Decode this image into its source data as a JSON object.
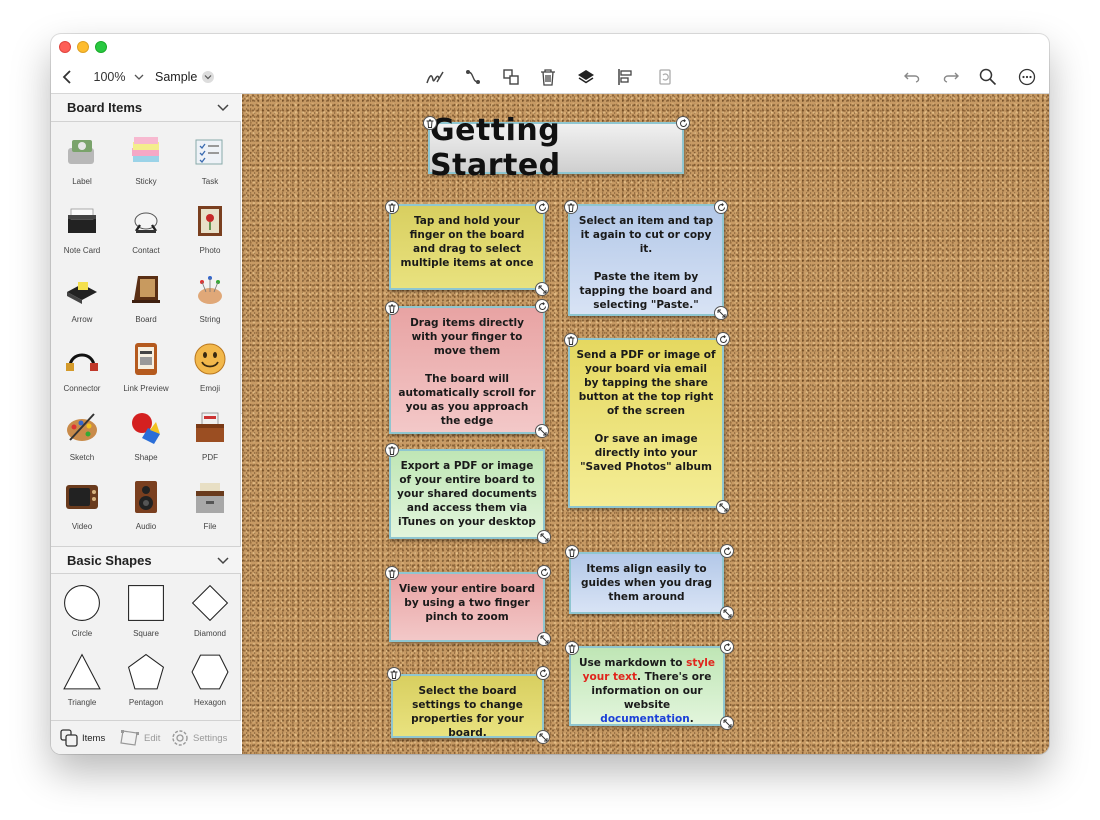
{
  "toolbar": {
    "zoom": "100%",
    "board_name": "Sample"
  },
  "sidebar": {
    "board_items_title": "Board Items",
    "items": [
      {
        "label": "Label"
      },
      {
        "label": "Sticky"
      },
      {
        "label": "Task"
      },
      {
        "label": "Note Card"
      },
      {
        "label": "Contact"
      },
      {
        "label": "Photo"
      },
      {
        "label": "Arrow"
      },
      {
        "label": "Board"
      },
      {
        "label": "String"
      },
      {
        "label": "Connector"
      },
      {
        "label": "Link Preview"
      },
      {
        "label": "Emoji"
      },
      {
        "label": "Sketch"
      },
      {
        "label": "Shape"
      },
      {
        "label": "PDF"
      },
      {
        "label": "Video"
      },
      {
        "label": "Audio"
      },
      {
        "label": "File"
      }
    ],
    "basic_shapes_title": "Basic Shapes",
    "shapes": [
      {
        "label": "Circle"
      },
      {
        "label": "Square"
      },
      {
        "label": "Diamond"
      },
      {
        "label": "Triangle"
      },
      {
        "label": "Pentagon"
      },
      {
        "label": "Hexagon"
      }
    ],
    "tabs": [
      {
        "label": "Items"
      },
      {
        "label": "Edit"
      },
      {
        "label": "Settings"
      }
    ]
  },
  "board": {
    "title": "Getting Started",
    "notes": {
      "n1": {
        "text": "Tap and hold your finger on the board and drag to select multiple items at once"
      },
      "n2": {
        "p1": "Select an item and tap it again to cut or copy it.",
        "p2": "Paste the item by tapping the board and selecting \"Paste.\""
      },
      "n3": {
        "p1": "Drag items directly with your finger to move them",
        "p2": "The board will automatically scroll for you as you approach the edge"
      },
      "n4": {
        "p1": "Send a PDF or image of your board via email by tapping the share button at the top right of the screen",
        "p2": "Or save an image directly into your \"Saved Photos\" album"
      },
      "n5": {
        "text": "Export a PDF or image of your entire board to your shared documents and access them via iTunes on your desktop"
      },
      "n6": {
        "text": "Items align easily to guides when you drag them around"
      },
      "n7": {
        "text": "View your entire board by using a two finger pinch to zoom"
      },
      "n8": {
        "pre": "Use ",
        "bold": "markdown",
        "mid": " to ",
        "red": "style your text",
        "post": ".  There's ore information on our website ",
        "link": "documentation",
        "end": "."
      },
      "n9": {
        "text": "Select the board settings to change properties for your board."
      }
    }
  },
  "colors": {
    "cork": "#c79a64",
    "note_border": "#8fc6d0",
    "red_text": "#e0241b",
    "link": "#1a3fd8"
  }
}
